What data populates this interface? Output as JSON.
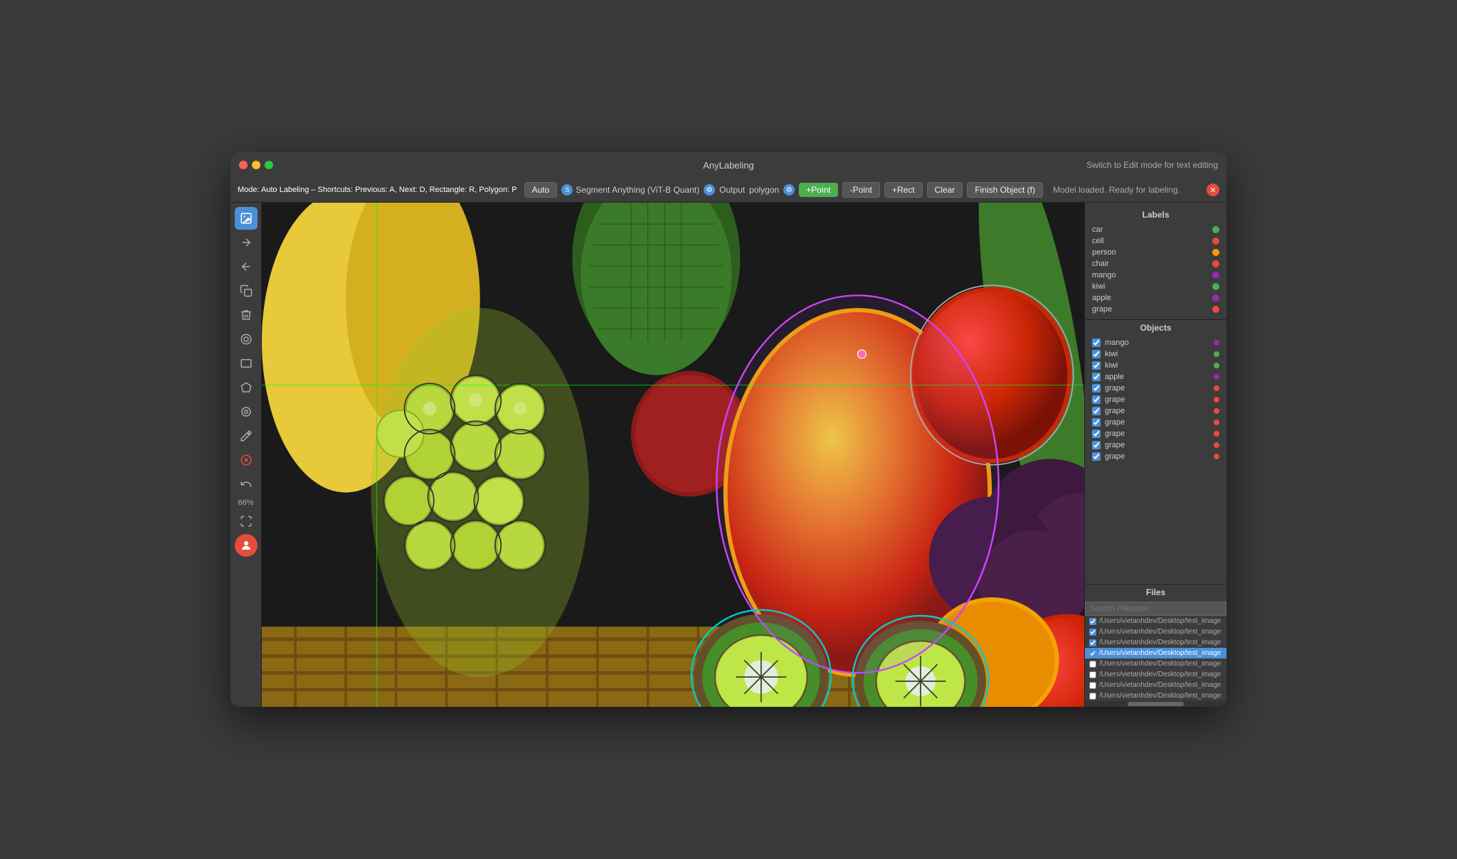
{
  "window": {
    "title": "AnyLabeling"
  },
  "titlebar": {
    "title": "AnyLabeling",
    "switch_edit_label": "Switch to Edit mode for text editing"
  },
  "toolbar": {
    "mode_label": "Mode:",
    "mode_value": "Auto Labeling",
    "shortcuts_label": "Shortcuts: Previous: A, Next: D, Rectangle: R, Polygon: P",
    "auto_label": "Auto",
    "model_label": "Segment Anything (ViT-B Quant)",
    "output_label": "Output",
    "polygon_label": "polygon",
    "plus_point_label": "+Point",
    "minus_point_label": "-Point",
    "plus_rect_label": "+Rect",
    "clear_label": "Clear",
    "finish_object_label": "Finish Object (f)",
    "status_text": "Model loaded. Ready for labeling."
  },
  "left_sidebar": {
    "icons": [
      {
        "name": "image-icon",
        "symbol": "🖼",
        "active": true
      },
      {
        "name": "forward-icon",
        "symbol": "→"
      },
      {
        "name": "back-icon",
        "symbol": "←"
      },
      {
        "name": "copy-icon",
        "symbol": "⧉"
      },
      {
        "name": "delete-icon",
        "symbol": "🗑"
      },
      {
        "name": "circle-icon",
        "symbol": "◎"
      },
      {
        "name": "rect-icon",
        "symbol": "▭"
      },
      {
        "name": "polygon-icon",
        "symbol": "⬡"
      },
      {
        "name": "point-icon",
        "symbol": "⊙"
      },
      {
        "name": "brush-icon",
        "symbol": "✏"
      },
      {
        "name": "cancel-icon",
        "symbol": "✕"
      },
      {
        "name": "undo-icon",
        "symbol": "↺"
      }
    ],
    "zoom_label": "66%",
    "fit-icon": "⊞",
    "avatar-icon": "👤"
  },
  "labels_panel": {
    "title": "Labels",
    "items": [
      {
        "name": "car",
        "color": "#4caf50"
      },
      {
        "name": "cell",
        "color": "#e74c3c"
      },
      {
        "name": "person",
        "color": "#ff9800"
      },
      {
        "name": "chair",
        "color": "#e74c3c"
      },
      {
        "name": "mango",
        "color": "#9c27b0"
      },
      {
        "name": "kiwi",
        "color": "#4caf50"
      },
      {
        "name": "apple",
        "color": "#9c27b0"
      },
      {
        "name": "grape",
        "color": "#e74c3c"
      }
    ]
  },
  "objects_panel": {
    "title": "Objects",
    "items": [
      {
        "name": "mango",
        "color": "#9c27b0",
        "checked": true
      },
      {
        "name": "kiwi",
        "color": "#4caf50",
        "checked": true
      },
      {
        "name": "kiwi",
        "color": "#4caf50",
        "checked": true
      },
      {
        "name": "apple",
        "color": "#9c27b0",
        "checked": true
      },
      {
        "name": "grape",
        "color": "#e74c3c",
        "checked": true
      },
      {
        "name": "grape",
        "color": "#e74c3c",
        "checked": true
      },
      {
        "name": "grape",
        "color": "#e74c3c",
        "checked": true
      },
      {
        "name": "grape",
        "color": "#e74c3c",
        "checked": true
      },
      {
        "name": "grape",
        "color": "#e74c3c",
        "checked": true
      },
      {
        "name": "grape",
        "color": "#e74c3c",
        "checked": true
      },
      {
        "name": "grape",
        "color": "#e74c3c",
        "checked": true
      }
    ]
  },
  "files_panel": {
    "title": "Files",
    "search_placeholder": "Search Filename",
    "items": [
      {
        "path": "/Users/vietanhdev/Desktop/test_image",
        "checked": true,
        "active": false
      },
      {
        "path": "/Users/vietanhdev/Desktop/test_image",
        "checked": true,
        "active": false
      },
      {
        "path": "/Users/vietanhdev/Desktop/test_image",
        "checked": true,
        "active": false
      },
      {
        "path": "/Users/vietanhdev/Desktop/test_image",
        "checked": true,
        "active": true
      },
      {
        "path": "/Users/vietanhdev/Desktop/test_image",
        "checked": false,
        "active": false
      },
      {
        "path": "/Users/vietanhdev/Desktop/test_image",
        "checked": false,
        "active": false
      },
      {
        "path": "/Users/vietanhdev/Desktop/test_image",
        "checked": false,
        "active": false
      },
      {
        "path": "/Users/vietanhdev/Desktop/test_image",
        "checked": false,
        "active": false
      }
    ]
  }
}
